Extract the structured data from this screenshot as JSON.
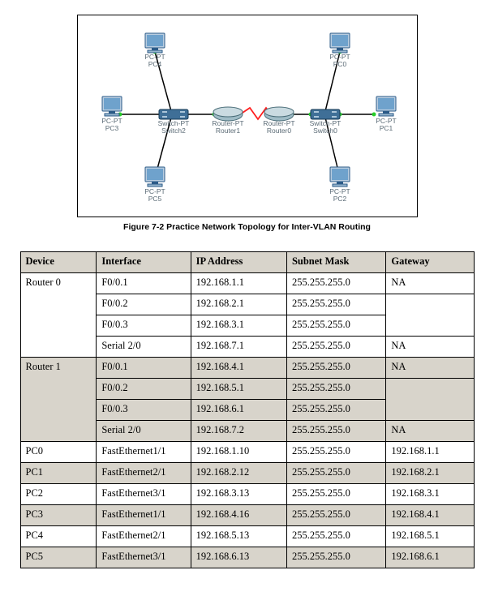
{
  "diagram": {
    "caption": "Figure 7-2 Practice Network Topology for Inter-VLAN Routing",
    "devices": {
      "pc4": {
        "l1": "PC-PT",
        "l2": "PC4"
      },
      "pc0": {
        "l1": "PC-PT",
        "l2": "PC0"
      },
      "pc3": {
        "l1": "PC-PT",
        "l2": "PC3"
      },
      "switch2": {
        "l1": "Switch-PT",
        "l2": "Switch2"
      },
      "router1": {
        "l1": "Router-PT",
        "l2": "Router1"
      },
      "router0": {
        "l1": "Router-PT",
        "l2": "Router0"
      },
      "switch0": {
        "l1": "Switch-PT",
        "l2": "Switch0"
      },
      "pc1": {
        "l1": "PC-PT",
        "l2": "PC1"
      },
      "pc5": {
        "l1": "PC-PT",
        "l2": "PC5"
      },
      "pc2": {
        "l1": "PC-PT",
        "l2": "PC2"
      }
    }
  },
  "table": {
    "headers": {
      "device": "Device",
      "interface": "Interface",
      "ip": "IP Address",
      "mask": "Subnet Mask",
      "gateway": "Gateway"
    },
    "rows": [
      {
        "device": "Router 0",
        "iface": "F0/0.1",
        "ip": "192.168.1.1",
        "mask": "255.255.255.0",
        "gw": "NA",
        "shade": false,
        "devspan": 4,
        "gwspan": 1
      },
      {
        "device": "",
        "iface": "F0/0.2",
        "ip": "192.168.2.1",
        "mask": "255.255.255.0",
        "gw": "",
        "shade": false,
        "gwspan": 2
      },
      {
        "device": "",
        "iface": "F0/0.3",
        "ip": "192.168.3.1",
        "mask": "255.255.255.0",
        "gw": "",
        "shade": false
      },
      {
        "device": "",
        "iface": "Serial 2/0",
        "ip": "192.168.7.1",
        "mask": "255.255.255.0",
        "gw": "NA",
        "shade": false,
        "gwspan": 1
      },
      {
        "device": "Router 1",
        "iface": "F0/0.1",
        "ip": "192.168.4.1",
        "mask": "255.255.255.0",
        "gw": "NA",
        "shade": true,
        "devspan": 4,
        "gwspan": 1
      },
      {
        "device": "",
        "iface": "F0/0.2",
        "ip": "192.168.5.1",
        "mask": "255.255.255.0",
        "gw": "",
        "shade": true,
        "gwspan": 2
      },
      {
        "device": "",
        "iface": "F0/0.3",
        "ip": "192.168.6.1",
        "mask": "255.255.255.0",
        "gw": "",
        "shade": true
      },
      {
        "device": "",
        "iface": "Serial 2/0",
        "ip": "192.168.7.2",
        "mask": "255.255.255.0",
        "gw": "NA",
        "shade": true,
        "gwspan": 1
      },
      {
        "device": "PC0",
        "iface": "FastEthernet1/1",
        "ip": "192.168.1.10",
        "mask": "255.255.255.0",
        "gw": "192.168.1.1",
        "shade": false,
        "devspan": 1,
        "gwspan": 1
      },
      {
        "device": "PC1",
        "iface": "FastEthernet2/1",
        "ip": "192.168.2.12",
        "mask": "255.255.255.0",
        "gw": "192.168.2.1",
        "shade": true,
        "devspan": 1,
        "gwspan": 1
      },
      {
        "device": "PC2",
        "iface": "FastEthernet3/1",
        "ip": "192.168.3.13",
        "mask": "255.255.255.0",
        "gw": "192.168.3.1",
        "shade": false,
        "devspan": 1,
        "gwspan": 1
      },
      {
        "device": "PC3",
        "iface": "FastEthernet1/1",
        "ip": "192.168.4.16",
        "mask": "255.255.255.0",
        "gw": "192.168.4.1",
        "shade": true,
        "devspan": 1,
        "gwspan": 1
      },
      {
        "device": "PC4",
        "iface": "FastEthernet2/1",
        "ip": "192.168.5.13",
        "mask": "255.255.255.0",
        "gw": "192.168.5.1",
        "shade": false,
        "devspan": 1,
        "gwspan": 1
      },
      {
        "device": "PC5",
        "iface": "FastEthernet3/1",
        "ip": "192.168.6.13",
        "mask": "255.255.255.0",
        "gw": "192.168.6.1",
        "shade": true,
        "devspan": 1,
        "gwspan": 1
      }
    ]
  }
}
